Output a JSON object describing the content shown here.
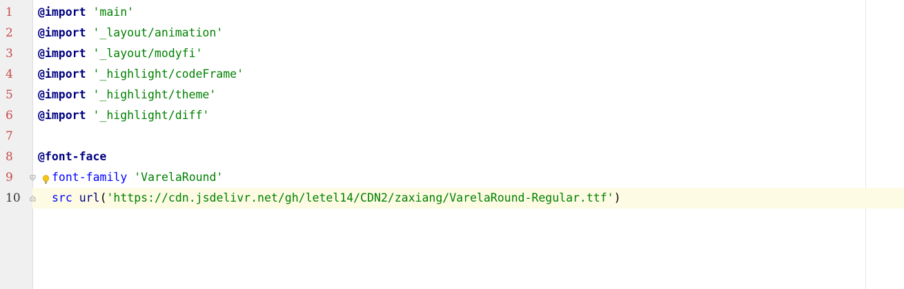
{
  "editor": {
    "lines": [
      {
        "num": "1",
        "kw": "@import",
        "str": "'main'"
      },
      {
        "num": "2",
        "kw": "@import",
        "str": "'_layout/animation'"
      },
      {
        "num": "3",
        "kw": "@import",
        "str": "'_layout/modyfi'"
      },
      {
        "num": "4",
        "kw": "@import",
        "str": "'_highlight/codeFrame'"
      },
      {
        "num": "5",
        "kw": "@import",
        "str": "'_highlight/theme'"
      },
      {
        "num": "6",
        "kw": "@import",
        "str": "'_highlight/diff'"
      },
      {
        "num": "7"
      },
      {
        "num": "8",
        "kw": "@font-face"
      },
      {
        "num": "9",
        "prop": "font-family",
        "str": "'VarelaRound'"
      },
      {
        "num": "10",
        "prop": "src",
        "fn": "url",
        "open": "(",
        "str": "'https://cdn.jsdelivr.net/gh/letel14/CDN2/zaxiang/VarelaRound-Regular.ttf'",
        "close": ")"
      }
    ],
    "current_line": "10",
    "colors": {
      "gutter_bg": "#f0f0f0",
      "line_number": "#c84b4b",
      "keyword": "#000080",
      "string": "#008000",
      "property": "#0000ff",
      "current_line_bg": "#fdfbe3"
    }
  }
}
